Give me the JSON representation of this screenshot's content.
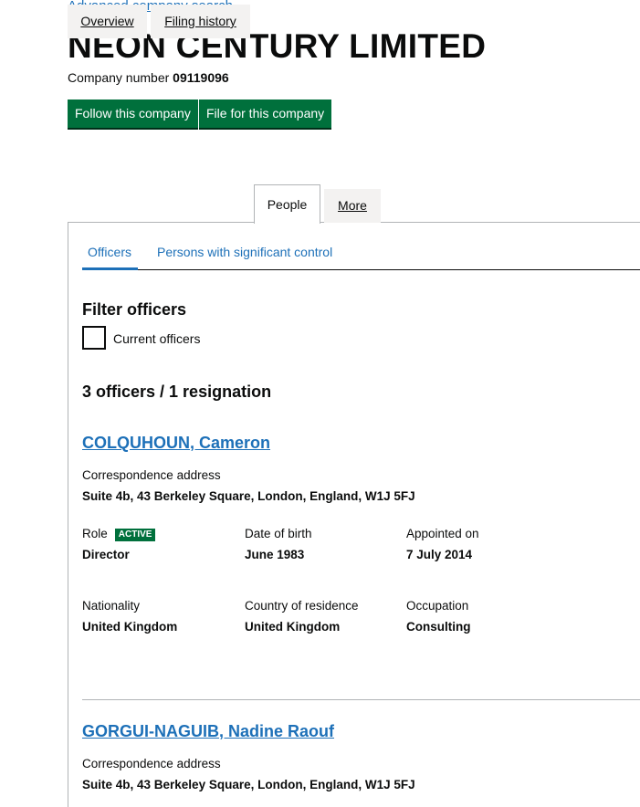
{
  "header": {
    "advanced_search_link": "Advanced company search",
    "company_name": "NEON CENTURY LIMITED",
    "company_number_label": "Company number",
    "company_number": "09119096",
    "follow_button": "Follow this company",
    "file_button": "File for this company"
  },
  "tabs": [
    {
      "label": "Overview"
    },
    {
      "label": "Filing history"
    },
    {
      "label": "People"
    },
    {
      "label": "More"
    }
  ],
  "subtabs": [
    {
      "label": "Officers"
    },
    {
      "label": "Persons with significant control"
    }
  ],
  "filter": {
    "heading": "Filter officers",
    "checkbox_label": "Current officers"
  },
  "summary": "3 officers / 1 resignation",
  "officers": [
    {
      "name": "COLQUHOUN, Cameron",
      "address_label": "Correspondence address",
      "address": "Suite 4b, 43 Berkeley Square, London, England, W1J 5FJ",
      "role_label": "Role",
      "status": "ACTIVE",
      "role": "Director",
      "dob_label": "Date of birth",
      "dob": "June 1983",
      "appointed_label": "Appointed on",
      "appointed": "7 July 2014",
      "nationality_label": "Nationality",
      "nationality": "United Kingdom",
      "residence_label": "Country of residence",
      "residence": "United Kingdom",
      "occupation_label": "Occupation",
      "occupation": "Consulting"
    },
    {
      "name": "GORGUI-NAGUIB, Nadine Raouf",
      "address_label": "Correspondence address",
      "address": "Suite 4b, 43 Berkeley Square, London, England, W1J 5FJ"
    }
  ],
  "colors": {
    "link": "#1d70b8",
    "button": "#00703c",
    "badge": "#00703c"
  }
}
